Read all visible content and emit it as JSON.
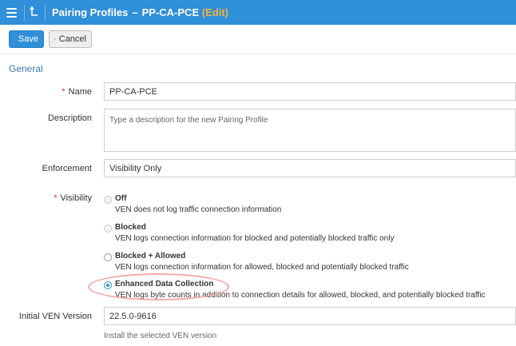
{
  "header": {
    "title": "Pairing Profiles",
    "dash": "–",
    "profile_name": "PP-CA-PCE",
    "edit_label": "(Edit)",
    "menu_icon": "hamburger-menu-icon",
    "up_icon": "level-up-icon",
    "bg_color": "#2f8fd8"
  },
  "toolbar": {
    "save_label": "Save",
    "cancel_label": "Cancel"
  },
  "section": {
    "title": "General"
  },
  "form": {
    "name_label": "Name",
    "name_value": "PP-CA-PCE",
    "description_label": "Description",
    "description_placeholder": "Type a description for the new Pairing Profile",
    "enforcement_label": "Enforcement",
    "enforcement_value": "Visibility Only",
    "visibility_label": "Visibility",
    "visibility_options": [
      {
        "label": "Off",
        "desc": "VEN does not log traffic connection information"
      },
      {
        "label": "Blocked",
        "desc": "VEN logs connection information for blocked and potentially blocked traffic only"
      },
      {
        "label": "Blocked + Allowed",
        "desc": "VEN logs connection information for allowed, blocked and potentially blocked traffic"
      },
      {
        "label": "Enhanced Data Collection",
        "desc": "VEN logs byte counts in addition to connection details for allowed, blocked, and potentially blocked traffic"
      }
    ],
    "visibility_selected": "Enhanced Data Collection",
    "ven_version_label": "Initial VEN Version",
    "ven_version_value": "22.5.0-9616",
    "ven_version_help": "Install the selected VEN version"
  },
  "colors": {
    "accent": "#2f8fd8",
    "edit": "#f4b23a",
    "required": "#e0262c",
    "highlight_ring": "#f4a8a8"
  }
}
